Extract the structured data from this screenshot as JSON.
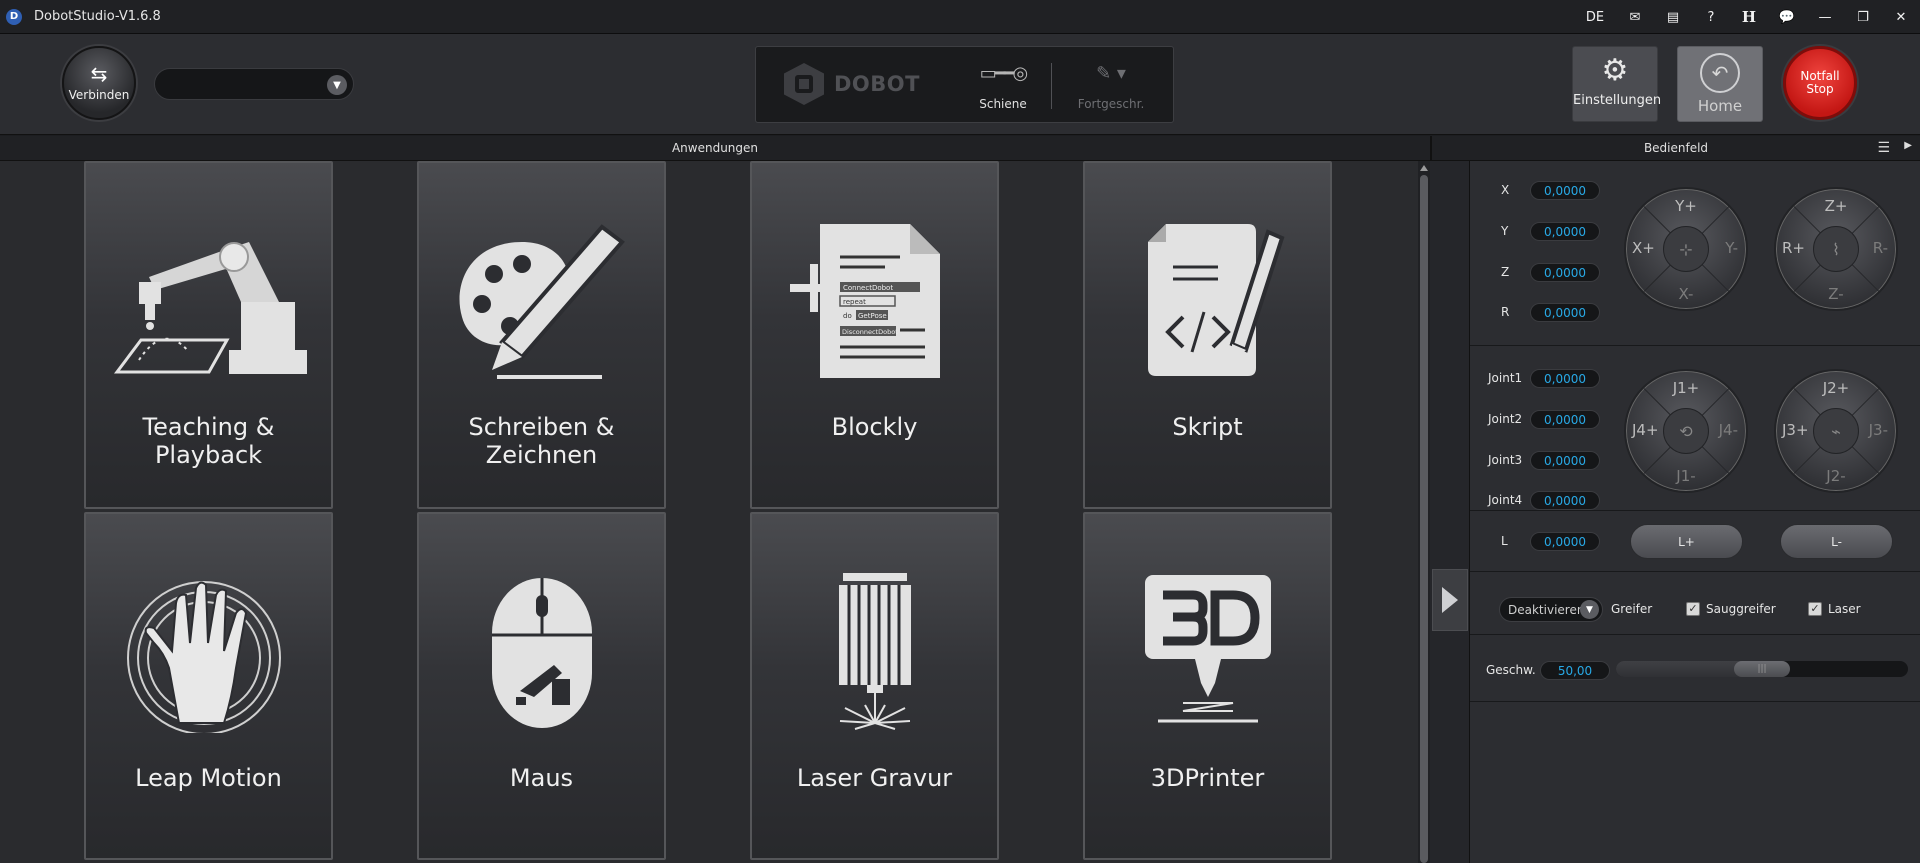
{
  "window": {
    "title": "DobotStudio-V1.6.8",
    "language": "DE",
    "icons": [
      "mail-icon",
      "news-icon",
      "help-icon",
      "h-icon",
      "chat-icon",
      "minimize-icon",
      "restore-icon",
      "close-icon"
    ]
  },
  "toolbar": {
    "connect_label": "Verbinden",
    "port_value": "",
    "device_brand": "DOBOT",
    "rail_label": "Schiene",
    "advanced_label": "Fortgeschr.",
    "settings_label": "Einstellungen",
    "home_label": "Home",
    "estop_line1": "Notfall",
    "estop_line2": "Stop"
  },
  "apps": {
    "header": "Anwendungen",
    "tiles": [
      {
        "label": "Teaching & Playback",
        "icon": "robot-arm-icon"
      },
      {
        "label": "Schreiben & Zeichnen",
        "icon": "palette-pencil-icon"
      },
      {
        "label": "Blockly",
        "icon": "blockly-document-icon"
      },
      {
        "label": "Skript",
        "icon": "script-document-icon"
      },
      {
        "label": "Leap Motion",
        "icon": "hand-icon"
      },
      {
        "label": "Maus",
        "icon": "mouse-icon"
      },
      {
        "label": "Laser Gravur",
        "icon": "laser-icon"
      },
      {
        "label": "3DPrinter",
        "icon": "3d-printer-icon"
      }
    ],
    "blockly_snippet": [
      "ConnectDobot",
      "repeat",
      "do",
      "GetPose",
      "DisconnectDobot"
    ]
  },
  "panel": {
    "header": "Bedienfeld",
    "cartesian": [
      {
        "label": "X",
        "value": "0,0000"
      },
      {
        "label": "Y",
        "value": "0,0000"
      },
      {
        "label": "Z",
        "value": "0,0000"
      },
      {
        "label": "R",
        "value": "0,0000"
      }
    ],
    "joints": [
      {
        "label": "Joint1",
        "value": "0,0000"
      },
      {
        "label": "Joint2",
        "value": "0,0000"
      },
      {
        "label": "Joint3",
        "value": "0,0000"
      },
      {
        "label": "Joint4",
        "value": "0,0000"
      }
    ],
    "jog_xy": {
      "top": "Y+",
      "left": "X+",
      "right": "Y-",
      "bottom": "X-"
    },
    "jog_zr": {
      "top": "Z+",
      "left": "R+",
      "right": "R-",
      "bottom": "Z-"
    },
    "jog_j14": {
      "top": "J1+",
      "left": "J4+",
      "right": "J4-",
      "bottom": "J1-"
    },
    "jog_j23": {
      "top": "J2+",
      "left": "J3+",
      "right": "J3-",
      "bottom": "J2-"
    },
    "l": {
      "label": "L",
      "value": "0,0000",
      "plus": "L+",
      "minus": "L-"
    },
    "gripper": {
      "select_value": "Deaktivieren",
      "greifer_label": "Greifer",
      "sauggreifer_label": "Sauggreifer",
      "laser_label": "Laser",
      "sauggreifer_checked": true,
      "laser_checked": true
    },
    "speed": {
      "label": "Geschw.",
      "value": "50,00",
      "fraction": 0.5
    }
  }
}
